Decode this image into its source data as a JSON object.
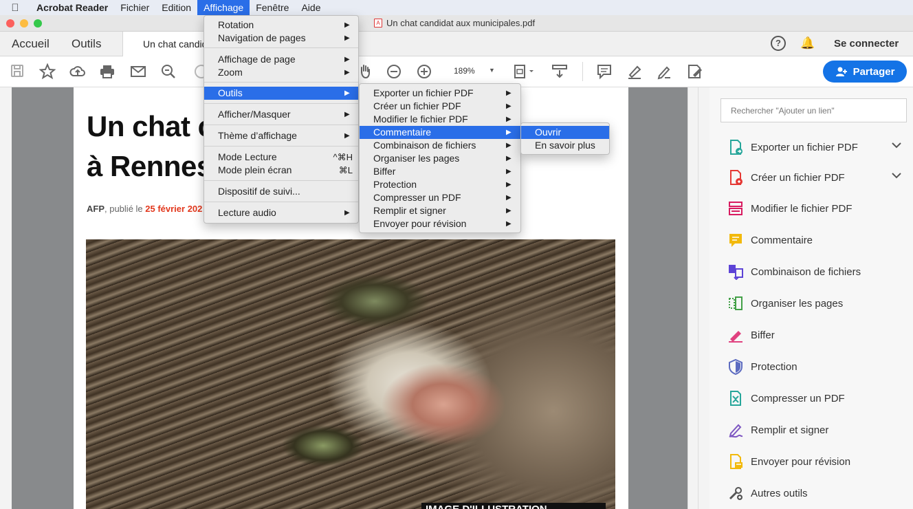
{
  "menubar": {
    "app": "Acrobat Reader",
    "items": [
      "Fichier",
      "Edition",
      "Affichage",
      "Fenêtre",
      "Aide"
    ]
  },
  "window": {
    "title": "Un chat candidat aux municipales.pdf"
  },
  "tabs": {
    "home": "Accueil",
    "tools": "Outils",
    "doc": "Un chat candid"
  },
  "header": {
    "help": "?",
    "signin": "Se connecter"
  },
  "toolbar": {
    "zoom": "189%",
    "share": "Partager"
  },
  "document": {
    "headline_1": "Un chat c",
    "headline_2": "à Rennes",
    "byline_source": "AFP",
    "byline_text": ", publié le ",
    "byline_date": "25 février 202",
    "photo_caption": "IMAGE D'ILLUSTRATION"
  },
  "affichage_menu": [
    {
      "label": "Rotation",
      "arrow": true
    },
    {
      "label": "Navigation de pages",
      "arrow": true
    },
    {
      "label": "Affichage de page",
      "arrow": true
    },
    {
      "label": "Zoom",
      "arrow": true
    },
    {
      "label": "Outils",
      "arrow": true,
      "selected": true
    },
    {
      "label": "Afficher/Masquer",
      "arrow": true
    },
    {
      "label": "Thème d’affichage",
      "arrow": true
    },
    {
      "label": "Mode Lecture",
      "shortcut": "^⌘H"
    },
    {
      "label": "Mode plein écran",
      "shortcut": "⌘L"
    },
    {
      "label": "Dispositif de suivi..."
    },
    {
      "label": "Lecture audio",
      "arrow": true
    }
  ],
  "outils_menu": [
    "Exporter un fichier PDF",
    "Créer un fichier PDF",
    "Modifier le fichier PDF",
    "Commentaire",
    "Combinaison de fichiers",
    "Organiser les pages",
    "Biffer",
    "Protection",
    "Compresser un PDF",
    "Remplir et signer",
    "Envoyer pour révision"
  ],
  "commentaire_menu": [
    "Ouvrir",
    "En savoir plus"
  ],
  "right_panel": {
    "search_placeholder": "Rechercher \"Ajouter un lien\"",
    "tools": [
      {
        "label": "Exporter un fichier PDF",
        "icon": "export-pdf-icon",
        "color": "#26a69a"
      },
      {
        "label": "Créer un fichier PDF",
        "icon": "create-pdf-icon",
        "color": "#e53935"
      },
      {
        "label": "Modifier le fichier PDF",
        "icon": "edit-pdf-icon",
        "color": "#d81b60"
      },
      {
        "label": "Commentaire",
        "icon": "comment-icon",
        "color": "#f2b90c"
      },
      {
        "label": "Combinaison de fichiers",
        "icon": "combine-files-icon",
        "color": "#5c43d6"
      },
      {
        "label": "Organiser les pages",
        "icon": "organize-pages-icon",
        "color": "#43a047"
      },
      {
        "label": "Biffer",
        "icon": "redact-icon",
        "color": "#e0417f"
      },
      {
        "label": "Protection",
        "icon": "protect-icon",
        "color": "#5c6bc0"
      },
      {
        "label": "Compresser un PDF",
        "icon": "compress-pdf-icon",
        "color": "#26a69a"
      },
      {
        "label": "Remplir et signer",
        "icon": "fill-sign-icon",
        "color": "#7e57c2"
      },
      {
        "label": "Envoyer pour révision",
        "icon": "send-review-icon",
        "color": "#f2b90c"
      },
      {
        "label": "Autres outils",
        "icon": "more-tools-icon",
        "color": "#555555"
      }
    ]
  }
}
